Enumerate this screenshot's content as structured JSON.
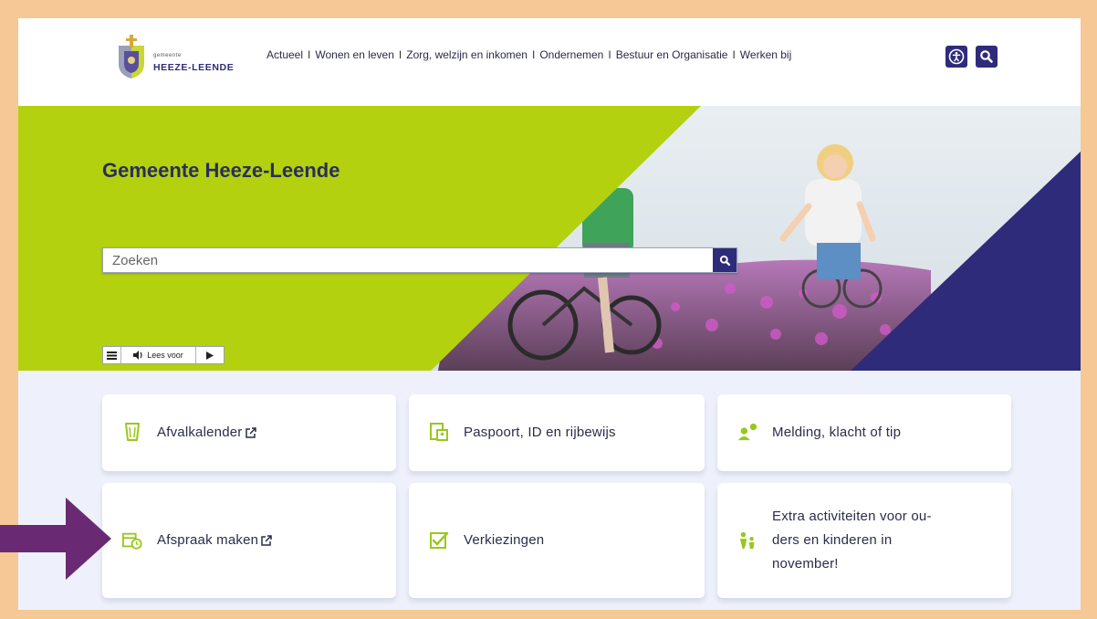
{
  "header": {
    "logo_small": "gemeente",
    "logo_name": "HEEZE-LEENDE",
    "nav": [
      "Actueel",
      "Wonen en leven",
      "Zorg, welzijn en inkomen",
      "Ondernemen",
      "Bestuur en Organisatie",
      "Werken bij"
    ],
    "separator": "I",
    "accessibility_icon": "accessibility-icon",
    "search_icon": "search-icon"
  },
  "hero": {
    "title": "Gemeente Heeze-Leende",
    "search_placeholder": "Zoeken",
    "readspeaker": {
      "menu_icon": "menu-icon",
      "label": "Lees voor",
      "play_icon": "play-icon"
    }
  },
  "tiles": [
    {
      "label": "Afvalkalender",
      "icon": "bin-icon",
      "external": true
    },
    {
      "label": "Paspoort, ID en rijbewijs",
      "icon": "id-card-icon",
      "external": false
    },
    {
      "label": "Melding, klacht of tip",
      "icon": "person-alert-icon",
      "external": false
    },
    {
      "label": "Afspraak maken",
      "icon": "calendar-clock-icon",
      "external": true
    },
    {
      "label": "Verkiezingen",
      "icon": "checkbox-icon",
      "external": false
    },
    {
      "label_lines": [
        "Extra activiteiten voor ou-",
        "ders en kinderen in",
        "november!"
      ],
      "icon": "family-icon",
      "external": false
    }
  ],
  "colors": {
    "frame": "#f5c896",
    "navy": "#2e2b7a",
    "lime": "#b3d10f",
    "arrow": "#6a2a73",
    "icon_green": "#9ac71c"
  }
}
